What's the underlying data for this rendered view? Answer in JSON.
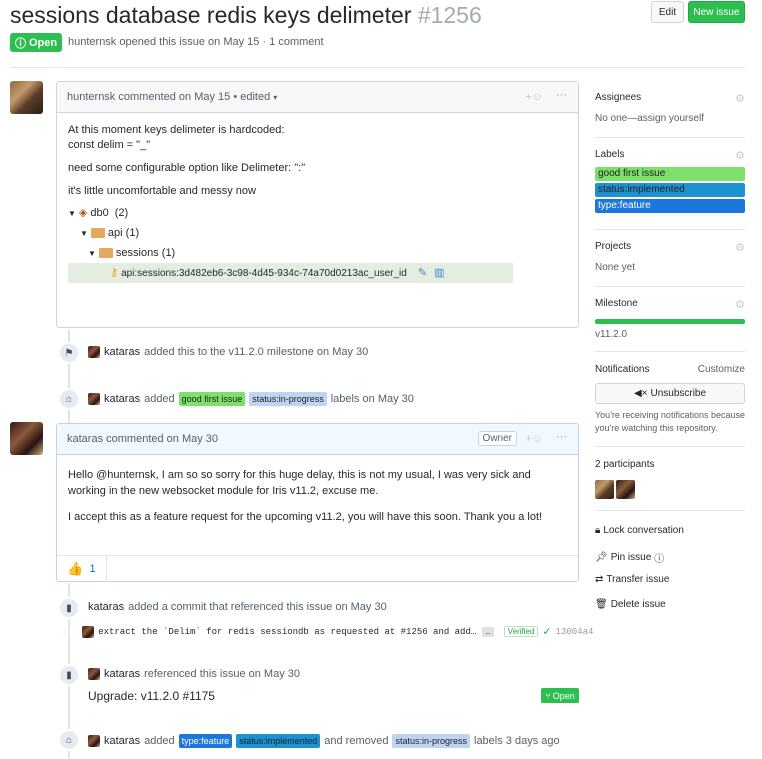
{
  "issue": {
    "title": "sessions database redis keys delimeter",
    "number": "#1256",
    "state": "Open",
    "meta_author": "hunternsk",
    "meta_rest": "opened this issue on May 15 · 1 comment"
  },
  "header_buttons": {
    "edit": "Edit",
    "new_issue": "New issue"
  },
  "first_comment": {
    "author": "hunternsk",
    "header_rest": "commented on May 15 • edited",
    "line1": "At this moment keys delimeter is hardcoded:",
    "line2": "const delim = \"_\"",
    "line3": "need some configurable option like Delimeter: \":\"",
    "line4": "it's little uncomfortable and messy now",
    "tree": {
      "db": "db0",
      "db_count": "(2)",
      "api": "api (1)",
      "sessions": "sessions (1)",
      "key": "api:sessions:3d482eb6-3c98-4d45-934c-74a70d0213ac_user_id"
    }
  },
  "event_milestone": {
    "who": "kataras",
    "text": "added this to the v11.2.0 milestone on May 30"
  },
  "event_labels": {
    "who": "kataras",
    "added": "added",
    "label1": "good first issue",
    "label2": "status:in-progress",
    "rest": "labels on May 30"
  },
  "second_comment": {
    "author": "kataras",
    "header_rest": "commented on May 30",
    "badge": "Owner",
    "p1": "Hello @hunternsk, I am so so sorry for this huge delay, this is not my usual, I was very sick and working in the new websocket module for Iris v11.2, excuse me.",
    "p2": "I accept this as a feature request for the upcoming v11.2, you will have this soon. Thank you a lot!",
    "reaction_count": "1"
  },
  "event_commit": {
    "who": "kataras",
    "text": "added a commit that referenced this issue on May 30",
    "commit_msg": "extract the `Delim` for redis sessiondb as requested at #1256 and add…",
    "ellipsis": "…",
    "verified": "Verified",
    "sha": "13004a4"
  },
  "event_ref": {
    "who": "kataras",
    "text": "referenced this issue on May 30",
    "title": "Upgrade: v11.2.0 #1175",
    "state": "Open"
  },
  "event_last": {
    "who": "kataras",
    "added": "added",
    "label1": "type:feature",
    "label2": "status:implemented",
    "removed": "and removed",
    "label3": "status:in-progress",
    "rest": "labels 3 days ago"
  },
  "sidebar": {
    "assignees_title": "Assignees",
    "assignees_value": "No one—assign yourself",
    "labels_title": "Labels",
    "labels": [
      {
        "name": "good first issue",
        "color": "#7ee06a"
      },
      {
        "name": "status:implemented",
        "color": "#1d92d0"
      },
      {
        "name": "type:feature",
        "color": "#1d76db"
      }
    ],
    "projects_title": "Projects",
    "projects_value": "None yet",
    "milestone_title": "Milestone",
    "milestone_progress": 1.0,
    "milestone_value": "v11.2.0",
    "notifications_title": "Notifications",
    "customize": "Customize",
    "unsubscribe": "Unsubscribe",
    "notif_text": "You're receiving notifications because you're watching this repository.",
    "participants_title": "2 participants",
    "lock": "Lock conversation",
    "pin": "Pin issue",
    "transfer": "Transfer issue",
    "delete": "Delete issue"
  }
}
